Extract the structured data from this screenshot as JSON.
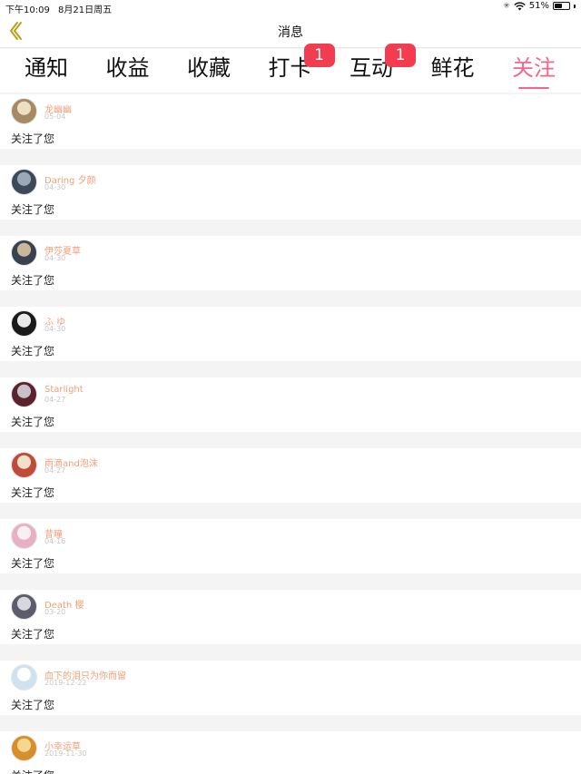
{
  "status_bar": {
    "time": "下午10:09",
    "date": "8月21日周五",
    "battery": "51%",
    "battery_level": 0.51
  },
  "nav": {
    "title": "消息"
  },
  "tabs": [
    {
      "label": "通知",
      "badge": "",
      "active": false
    },
    {
      "label": "收益",
      "badge": "",
      "active": false
    },
    {
      "label": "收藏",
      "badge": "",
      "active": false
    },
    {
      "label": "打卡",
      "badge": "1",
      "active": false
    },
    {
      "label": "互动",
      "badge": "1",
      "active": false
    },
    {
      "label": "鲜花",
      "badge": "",
      "active": false
    },
    {
      "label": "关注",
      "badge": "",
      "active": true
    }
  ],
  "notifications": [
    {
      "name": "龙幽幽",
      "date": "05-04",
      "action": "关注了您",
      "avatar_colors": [
        "#a58a63",
        "#ede0c2"
      ]
    },
    {
      "name": "Daring 夕颜",
      "date": "04-30",
      "action": "关注了您",
      "avatar_colors": [
        "#3e4a5a",
        "#9aa9b6"
      ]
    },
    {
      "name": "伊莎夏草",
      "date": "04-30",
      "action": "关注了您",
      "avatar_colors": [
        "#3a4252",
        "#c7b99a"
      ]
    },
    {
      "name": "ふ ゆ",
      "date": "04-30",
      "action": "关注了您",
      "avatar_colors": [
        "#1a1a1a",
        "#e8e8e8"
      ]
    },
    {
      "name": "Starlight",
      "date": "04-27",
      "action": "关注了您",
      "avatar_colors": [
        "#5b2230",
        "#c8c2c8"
      ]
    },
    {
      "name": "雨滴and泡沫",
      "date": "04-27",
      "action": "关注了您",
      "avatar_colors": [
        "#c24a3a",
        "#f3e0c9"
      ]
    },
    {
      "name": "昔瞳",
      "date": "04-16",
      "action": "关注了您",
      "avatar_colors": [
        "#e7b0c4",
        "#fbeff4"
      ]
    },
    {
      "name": "Death 樱",
      "date": "03-20",
      "action": "关注了您",
      "avatar_colors": [
        "#5b5c6c",
        "#d8d7df"
      ]
    },
    {
      "name": "血下的泪只为你而留",
      "date": "2019-12-22",
      "action": "关注了您",
      "avatar_colors": [
        "#cfe2ef",
        "#ffffff"
      ]
    },
    {
      "name": "小幸运草",
      "date": "2019-11-30",
      "action": "关注了您",
      "avatar_colors": [
        "#d68f2c",
        "#f5d890"
      ]
    }
  ],
  "colors": {
    "accent": "#f2668b",
    "badge": "#f23c4f",
    "username": "#ef9f78",
    "back_arrow": "#b8a018"
  }
}
